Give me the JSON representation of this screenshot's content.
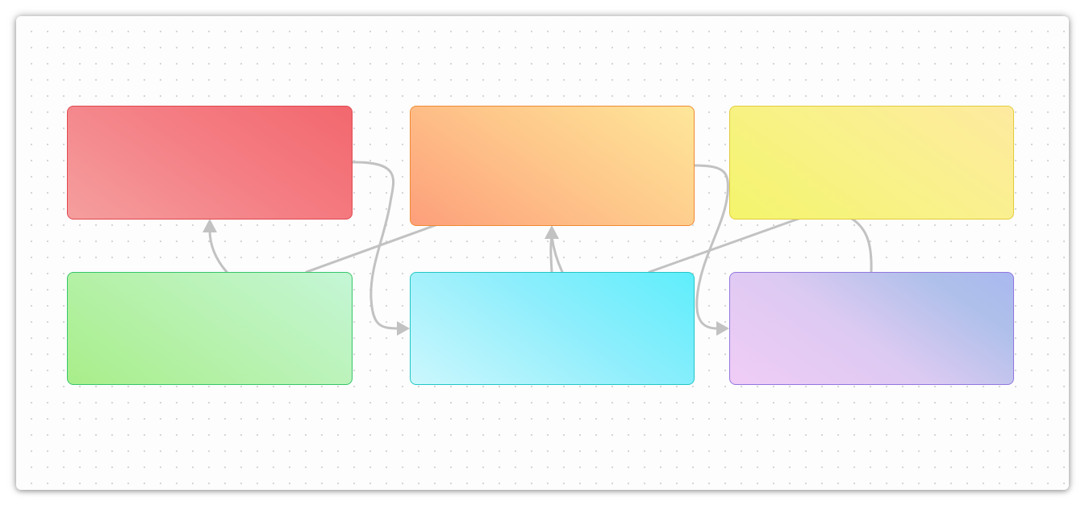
{
  "diagram": {
    "nodes": [
      {
        "id": "red",
        "label": "",
        "color": "#f47d83"
      },
      {
        "id": "orange",
        "label": "",
        "color": "#fec68a"
      },
      {
        "id": "yellow",
        "label": "",
        "color": "#f8f287"
      },
      {
        "id": "green",
        "label": "",
        "color": "#b8f2b0"
      },
      {
        "id": "cyan",
        "label": "",
        "color": "#8eeefc"
      },
      {
        "id": "purple",
        "label": "",
        "color": "#c8c2f0"
      }
    ],
    "edges": [
      {
        "from": "red",
        "to": "cyan",
        "arrow": true
      },
      {
        "from": "green",
        "to": "red",
        "arrow": true
      },
      {
        "from": "green",
        "to": "orange",
        "arrow": false
      },
      {
        "from": "cyan",
        "to": "orange",
        "arrow": true
      },
      {
        "from": "orange",
        "to": "purple",
        "arrow": true
      },
      {
        "from": "cyan",
        "to": "yellow",
        "arrow": false
      },
      {
        "from": "purple",
        "to": "yellow",
        "arrow": false
      }
    ],
    "edge_color": "#c2c2c2",
    "background": "dotted-grid"
  }
}
